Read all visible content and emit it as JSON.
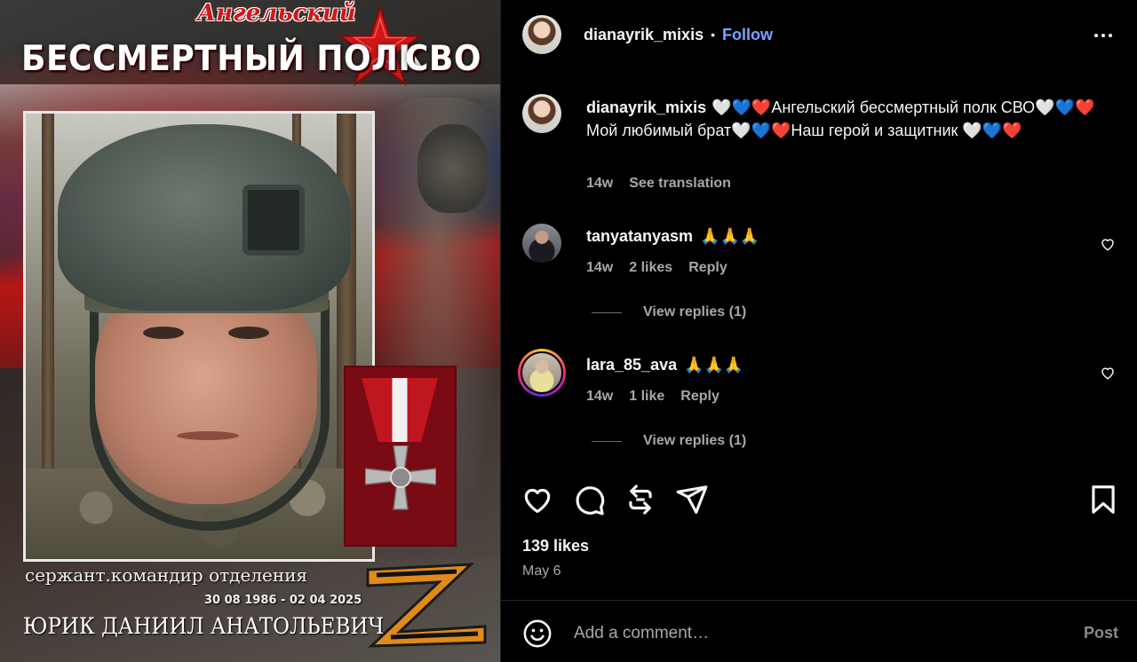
{
  "post_image": {
    "script_title": "Ангельский",
    "header_title": "БЕССМЕРТНЫЙ ПОЛК",
    "header_suffix": "СВО",
    "rank": "сержант.командир отделения",
    "dates": "30 08 1986 - 02 04 2025",
    "name": "ЮРИК ДАНИИЛ АНАТОЛЬЕВИЧ",
    "colors": {
      "red": "#c0161f",
      "white": "#f1f1f1",
      "blue": "#1c48a0"
    }
  },
  "header": {
    "username": "dianayrik_mixis",
    "separator": "•",
    "follow_label": "Follow",
    "more_icon": "more-horizontal-icon"
  },
  "caption": {
    "username": "dianayrik_mixis",
    "text": "🤍💙❤️Ангельский бессмертный полк СВО🤍💙❤️Мой любимый брат🤍💙❤️Наш герой и защитник 🤍💙❤️",
    "age": "14w",
    "see_translation": "See translation"
  },
  "comments": [
    {
      "username": "tanyatanyasm",
      "text": "🙏🙏🙏",
      "age": "14w",
      "likes": "2 likes",
      "reply": "Reply",
      "view_replies": "View replies (1)"
    },
    {
      "username": "lara_85_ava",
      "text": "🙏🙏🙏",
      "age": "14w",
      "likes": "1 like",
      "reply": "Reply",
      "view_replies": "View replies (1)"
    }
  ],
  "actions": {
    "like_icon": "heart-icon",
    "comment_icon": "comment-icon",
    "repost_icon": "repost-icon",
    "share_icon": "share-icon",
    "save_icon": "bookmark-icon"
  },
  "stats": {
    "likes": "139 likes",
    "date": "May 6"
  },
  "comment_box": {
    "placeholder": "Add a comment…",
    "post_label": "Post",
    "emoji_icon": "emoji-icon"
  },
  "colors": {
    "background": "#000000",
    "text": "#f5f5f5",
    "muted": "#a8a8a8",
    "link": "#7aa3ff"
  }
}
